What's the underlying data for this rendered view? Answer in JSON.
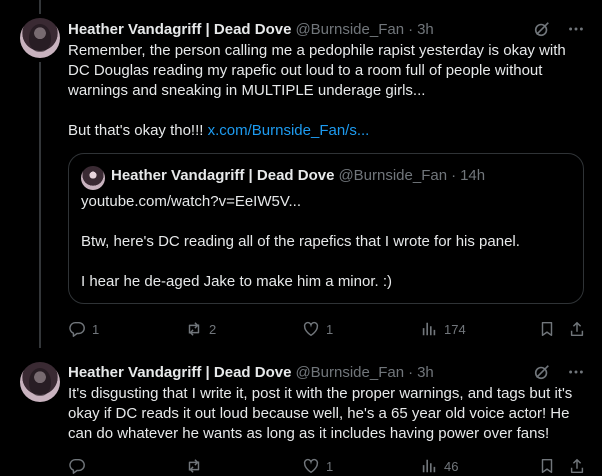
{
  "tweets": [
    {
      "name": "Heather Vandagriff | Dead Dove",
      "handle": "@Burnside_Fan",
      "time": "3h",
      "text": "Remember, the person calling me a pedophile rapist yesterday is okay with DC Douglas reading my rapefic out loud to a room full of people without warnings and sneaking in MULTIPLE underage girls...\n\nBut that's okay tho!!! ",
      "link": "x.com/Burnside_Fan/s...",
      "quote": {
        "name": "Heather Vandagriff | Dead Dove",
        "handle": "@Burnside_Fan",
        "time": "14h",
        "text": "youtube.com/watch?v=EeIW5V...\n\nBtw, here's DC reading all of the rapefics that I wrote for his panel.\n\nI hear he de-aged Jake to make him a minor. :)"
      },
      "actions": {
        "replies": "1",
        "reposts": "2",
        "likes": "1",
        "views": "174"
      }
    },
    {
      "name": "Heather Vandagriff | Dead Dove",
      "handle": "@Burnside_Fan",
      "time": "3h",
      "text": "It's disgusting that I write it, post it with the proper warnings, and tags but it's okay if DC reads it out loud because well, he's a 65 year old voice actor! He can do whatever he wants as long as it includes having power over fans!",
      "actions": {
        "replies": "",
        "reposts": "",
        "likes": "1",
        "views": "46"
      }
    }
  ],
  "colors": {
    "background": "#000000",
    "text": "#e7e9ea",
    "muted": "#71767b",
    "link": "#1d9bf0",
    "border": "#2f3336"
  },
  "icons": [
    "grok-icon",
    "more-icon",
    "reply-icon",
    "repost-icon",
    "like-icon",
    "views-icon",
    "bookmark-icon",
    "share-icon"
  ]
}
